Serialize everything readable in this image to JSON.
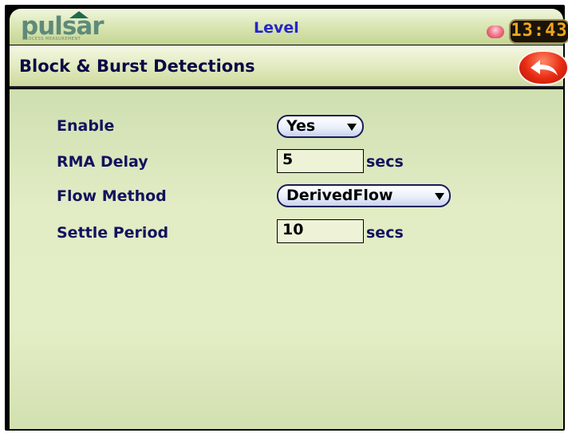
{
  "brand": {
    "logo_text": "pulsar",
    "logo_subtext": "PROCESS MEASUREMENT"
  },
  "topbar": {
    "title": "Level",
    "status_led_color": "#e0405a",
    "clock": "13:43"
  },
  "header": {
    "title": "Block & Burst Detections",
    "back_icon": "back-arrow-icon"
  },
  "settings": {
    "enable": {
      "label": "Enable",
      "value": "Yes"
    },
    "rma_delay": {
      "label": "RMA Delay",
      "value": "5",
      "unit": "secs"
    },
    "flow_method": {
      "label": "Flow Method",
      "value": "DerivedFlow"
    },
    "settle_period": {
      "label": "Settle Period",
      "value": "10",
      "unit": "secs"
    }
  },
  "colors": {
    "label_text": "#13125e",
    "title_text": "#2525c8",
    "back_button": "#e82a12",
    "clock_digits": "#f3a51c"
  }
}
